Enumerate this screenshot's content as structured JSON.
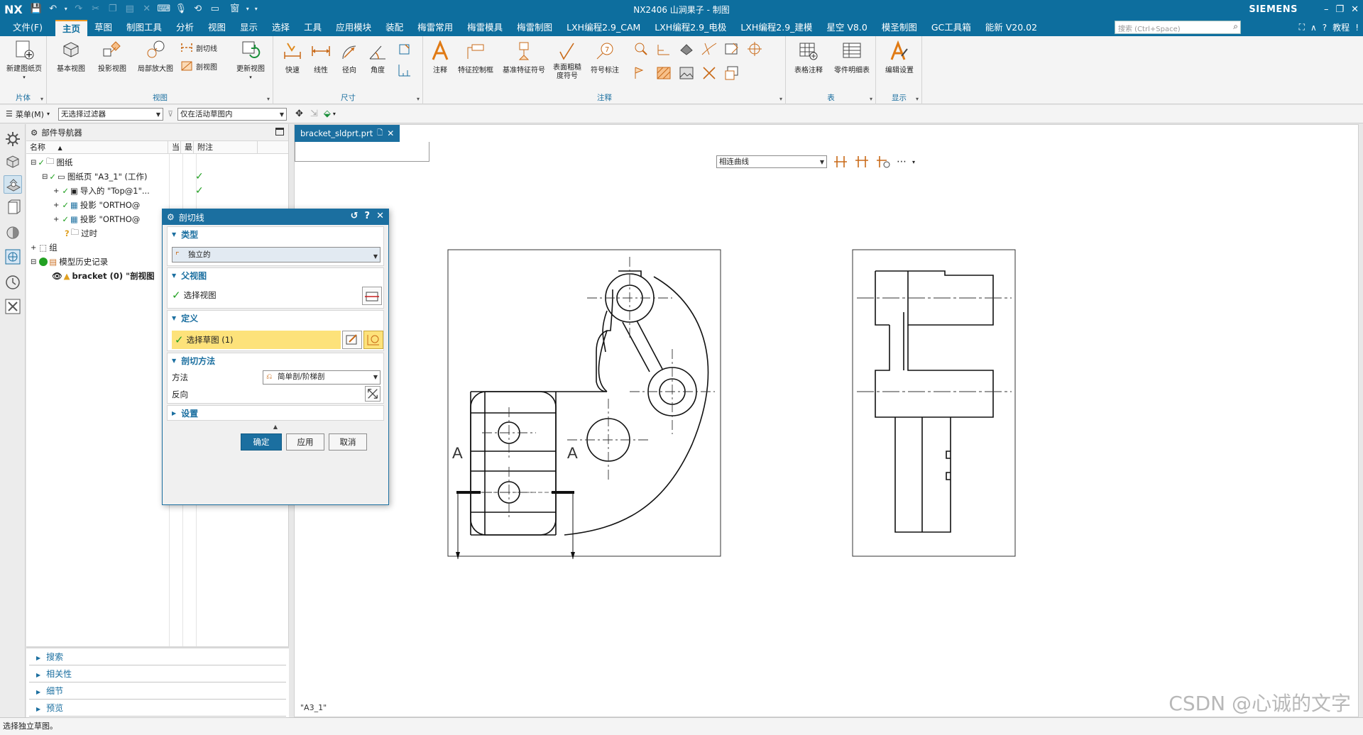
{
  "titlebar": {
    "logo": "NX",
    "window_menu": "窗口",
    "title": "NX2406 山涧果子 - 制图",
    "brand": "SIEMENS"
  },
  "menu_tabs": [
    "文件(F)",
    "主页",
    "草图",
    "制图工具",
    "分析",
    "视图",
    "显示",
    "选择",
    "工具",
    "应用模块",
    "装配",
    "梅雷常用",
    "梅雷模具",
    "梅雷制图",
    "LXH编程2.9_CAM",
    "LXH编程2.9_电极",
    "LXH编程2.9_建模",
    "星空 V8.0",
    "模圣制图",
    "GC工具箱",
    "能新 V20.02"
  ],
  "search": {
    "placeholder": "搜索 (Ctrl+Space)"
  },
  "help_link": "教程",
  "ribbon": {
    "groups": {
      "sheet": "片体",
      "view": "视图",
      "dimension": "尺寸",
      "annotation": "注释",
      "table": "表",
      "display": "显示"
    },
    "buttons": {
      "new_sheet": "新建图纸页",
      "base_view": "基本视图",
      "projected_view": "投影视图",
      "detail_view": "局部放大图",
      "section_line": "剖切线",
      "section_view": "剖视图",
      "update_view": "更新视图",
      "rapid": "快速",
      "linear": "线性",
      "radial": "径向",
      "angular": "角度",
      "note": "注释",
      "feature_control_frame": "特征控制框",
      "datum_feature_symbol": "基准特征符号",
      "surface_finish": "表面粗糙度符号",
      "symbol_label": "符号标注",
      "tabular_note": "表格注释",
      "parts_list": "零件明细表",
      "edit_settings": "编辑设置"
    }
  },
  "toolbar2": {
    "menu": "菜单(M)",
    "filter": "无选择过滤器",
    "scope": "仅在活动草图内"
  },
  "navigator": {
    "title": "部件导航器",
    "columns": [
      "名称",
      "当",
      "最",
      "附注"
    ],
    "rows": [
      {
        "label": "图纸",
        "check": ""
      },
      {
        "label": "图纸页 \"A3_1\" (工作)",
        "check": "✓"
      },
      {
        "label": "导入的 \"Top@1\"...",
        "check": "✓"
      },
      {
        "label": "投影 \"ORTHO@",
        "check": ""
      },
      {
        "label": "投影 \"ORTHO@",
        "check": ""
      },
      {
        "label": "过时",
        "check": ""
      },
      {
        "label": "组",
        "check": ""
      },
      {
        "label": "模型历史记录",
        "check": ""
      },
      {
        "label": "bracket (0) \"剖视图",
        "check": ""
      }
    ],
    "bottom_sections": [
      "搜索",
      "相关性",
      "细节",
      "预览"
    ]
  },
  "document_tab": "bracket_sldprt.prt",
  "selection_bar": {
    "curve_rule": "相连曲线"
  },
  "drawing": {
    "section_labels": [
      "A",
      "A"
    ],
    "sheet_name": "\"A3_1\""
  },
  "dialog": {
    "title": "剖切线",
    "type_section": "类型",
    "type_value": "独立的",
    "parent_view_section": "父视图",
    "select_view": "选择视图",
    "definition_section": "定义",
    "select_sketch": "选择草图 (1)",
    "section_method_section": "剖切方法",
    "method_label": "方法",
    "method_value": "简单剖/阶梯剖",
    "reverse_label": "反向",
    "settings_section": "设置",
    "ok": "确定",
    "apply": "应用",
    "cancel": "取消"
  },
  "status": "选择独立草图。",
  "watermark": "CSDN @心诚的文字",
  "colors": {
    "title_bar": "#0d6e9e",
    "accent": "#1b6fa0",
    "active_tab_border": "#f19a24",
    "highlight_row": "#fde27a",
    "check_green": "#22a022"
  }
}
